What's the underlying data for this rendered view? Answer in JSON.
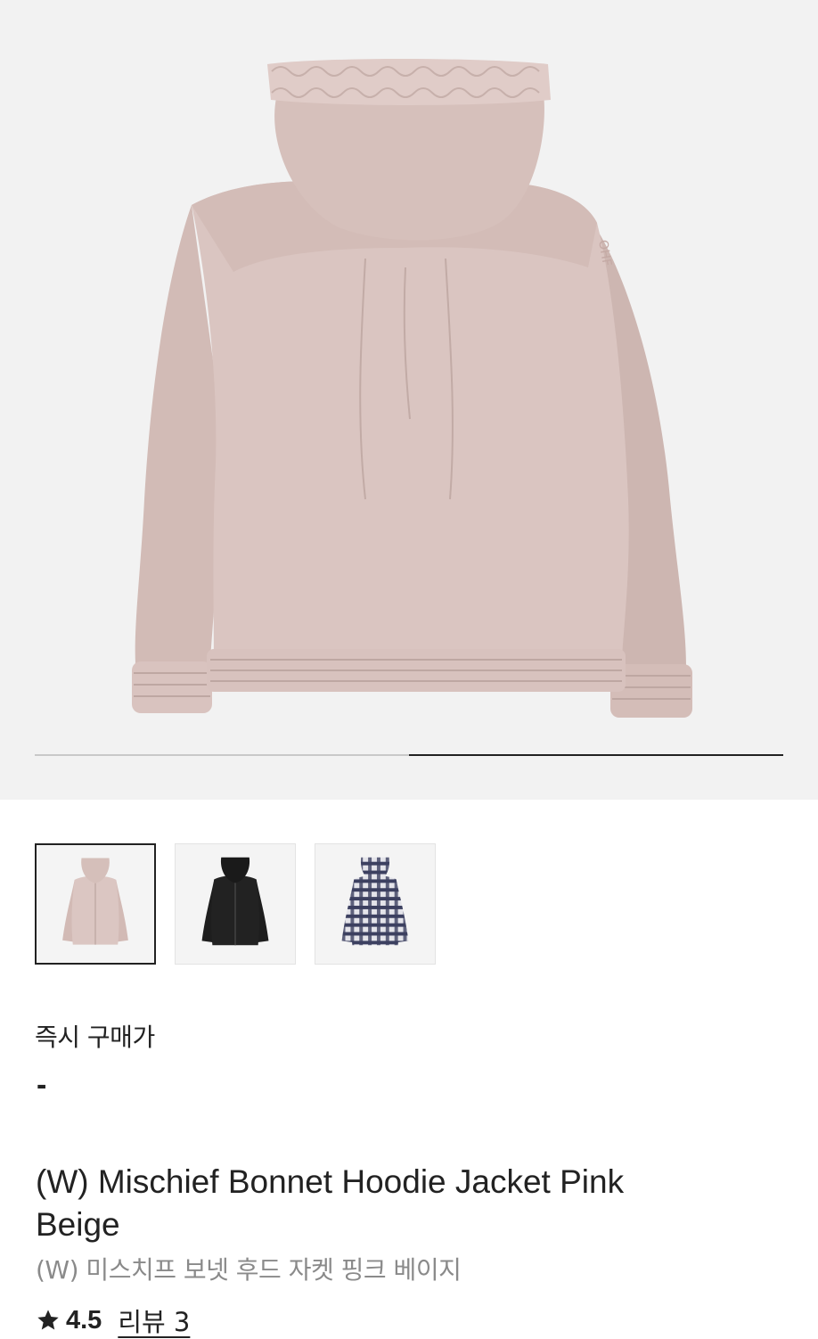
{
  "gallery": {
    "main_image_alt": "pink-beige hoodie jacket back view",
    "slide_index": 2,
    "slide_count": 2,
    "colors": {
      "track": "#c8c8c8",
      "indicator": "#222222",
      "bg": "#f2f2f2",
      "jacket": "#d9c3bf"
    }
  },
  "thumbnails": [
    {
      "color_name": "pink-beige",
      "swatch": "#d7c0bb",
      "selected": true
    },
    {
      "color_name": "black",
      "swatch": "#1a1a1a",
      "selected": false
    },
    {
      "color_name": "plaid",
      "swatch": "#4a4e66",
      "selected": false
    }
  ],
  "price": {
    "label": "즉시 구매가",
    "value": "-"
  },
  "product": {
    "title": "(W) Mischief Bonnet Hoodie Jacket Pink Beige",
    "subtitle": "(W) 미스치프 보넷 후드 자켓 핑크 베이지",
    "rating": "4.5",
    "review_label": "리뷰 3"
  }
}
